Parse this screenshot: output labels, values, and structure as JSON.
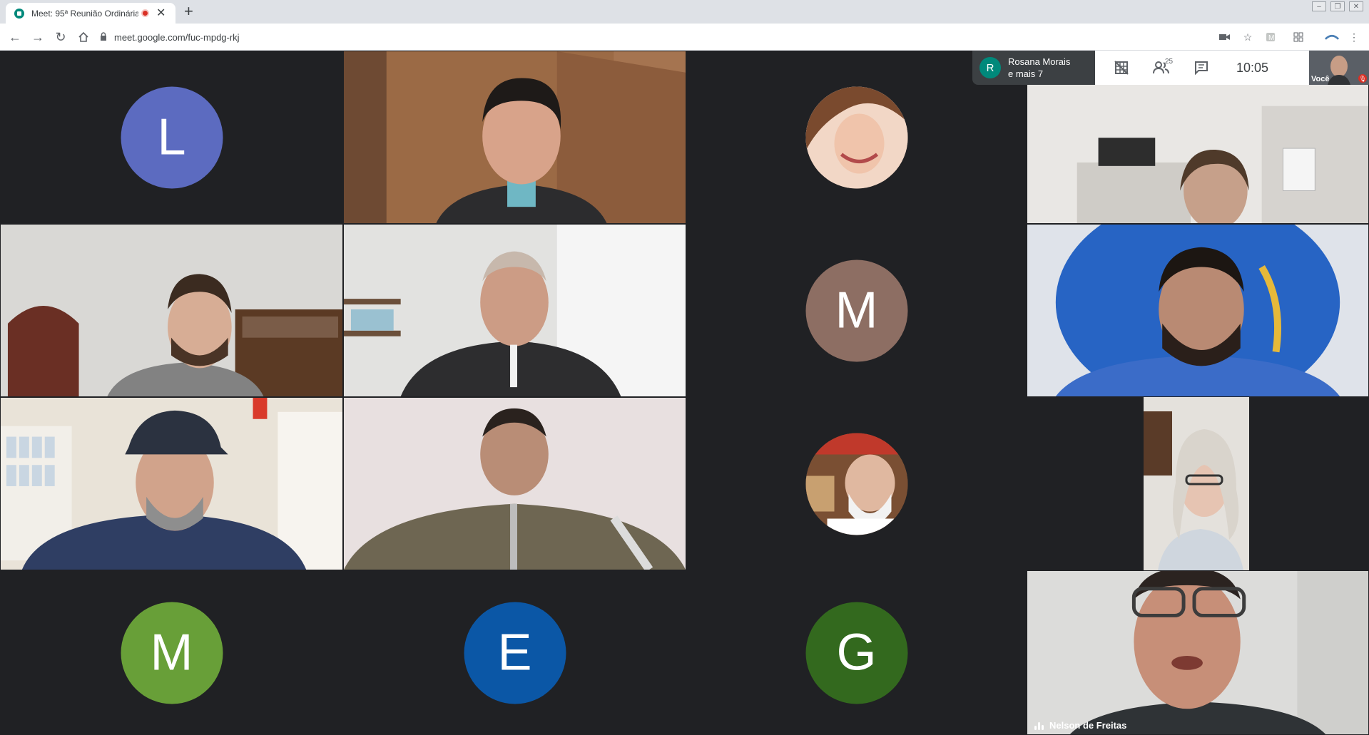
{
  "browser": {
    "tab_title": "Meet: 95ª Reunião Ordinária",
    "tab_close": "✕",
    "new_tab": "+",
    "url": "meet.google.com/fuc-mpdg-rkj"
  },
  "tiles": [
    {
      "name": "participant-l",
      "type": "avatar",
      "letter": "L",
      "color": "#5c6bc0"
    },
    {
      "name": "participant-video-1",
      "type": "video"
    },
    {
      "name": "participant-photo-1",
      "type": "photo"
    },
    {
      "name": "participant-video-2",
      "type": "video"
    },
    {
      "name": "participant-video-3",
      "type": "video"
    },
    {
      "name": "participant-video-4",
      "type": "video"
    },
    {
      "name": "participant-m-1",
      "type": "avatar",
      "letter": "M",
      "color": "#8d6e63"
    },
    {
      "name": "participant-video-5",
      "type": "video"
    },
    {
      "name": "participant-video-6",
      "type": "video"
    },
    {
      "name": "participant-video-7",
      "type": "video"
    },
    {
      "name": "participant-photo-2",
      "type": "photo"
    },
    {
      "name": "participant-video-8",
      "type": "video"
    },
    {
      "name": "participant-m-2",
      "type": "avatar",
      "letter": "M",
      "color": "#689f38"
    },
    {
      "name": "participant-e",
      "type": "avatar",
      "letter": "E",
      "color": "#0b57a6"
    },
    {
      "name": "participant-g",
      "type": "avatar",
      "letter": "G",
      "color": "#33691e"
    },
    {
      "name": "participant-video-nelson",
      "type": "video"
    }
  ],
  "meet": {
    "presenter_initial": "R",
    "presenter_line1": "Rosana Morais",
    "presenter_line2": "e mais 7",
    "participants_count": "25",
    "time": "10:05",
    "self_label": "Você",
    "speaker_name": "Nelson de Freitas"
  },
  "colors": {
    "background": "#202124",
    "accent": "#00897b",
    "recording": "#d93025"
  }
}
